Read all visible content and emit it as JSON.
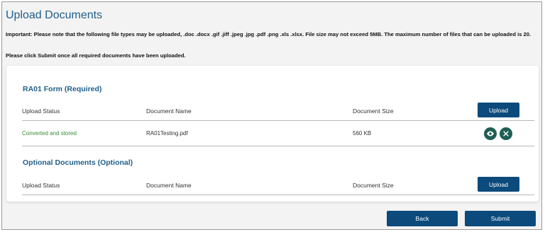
{
  "page": {
    "title": "Upload Documents",
    "notice": "Important: Please note that the following file types may be uploaded, .doc .docx .gif .jiff .jpeg .jpg .pdf .png .xls .xlsx. File size may not exceed 5MB. The maximum number of files that can be uploaded is 20.",
    "instruction": "Please click Submit once all required documents have been uploaded."
  },
  "required_section": {
    "title": "RA01 Form (Required)",
    "columns": {
      "status": "Upload Status",
      "name": "Document Name",
      "size": "Document Size"
    },
    "upload_label": "Upload",
    "rows": [
      {
        "status": "Converted and stored",
        "name": "RA01Testing.pdf",
        "size": "560 KB"
      }
    ]
  },
  "optional_section": {
    "title": "Optional Documents (Optional)",
    "columns": {
      "status": "Upload Status",
      "name": "Document Name",
      "size": "Document Size"
    },
    "upload_label": "Upload"
  },
  "footer": {
    "back_label": "Back",
    "submit_label": "Submit"
  },
  "icons": {
    "view": "eye-icon",
    "remove": "close-icon"
  },
  "colors": {
    "primary": "#0c4a7c",
    "title": "#1f5f8b",
    "success": "#3a8a3a",
    "icon_bg": "#1e5e55"
  }
}
